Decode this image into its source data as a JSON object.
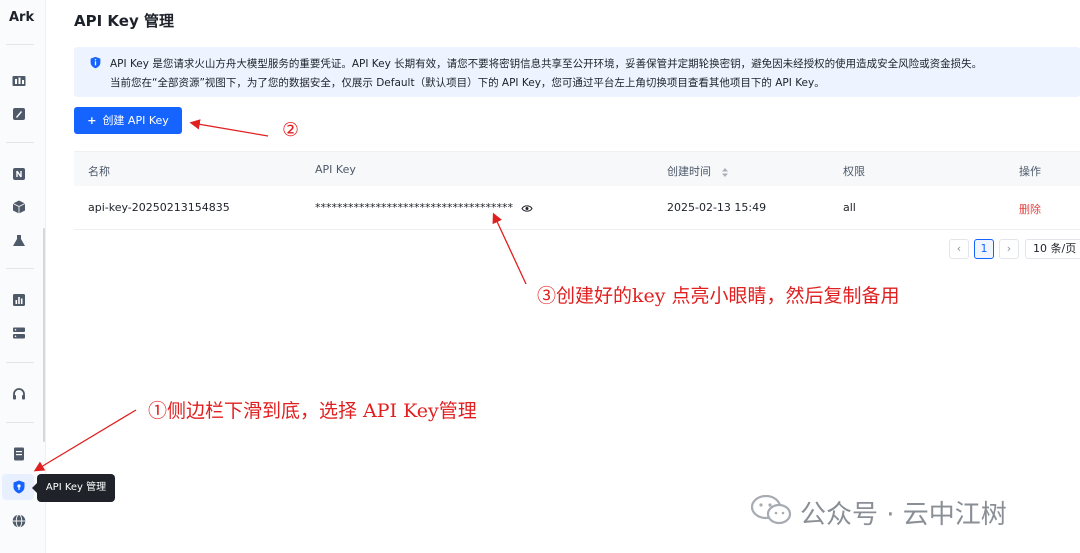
{
  "app": {
    "logo": "Ark"
  },
  "sidebar": {
    "icons": [
      "overview-icon",
      "rocket-icon",
      "model-icon",
      "box-icon",
      "flask-icon",
      "chart-icon",
      "server-icon",
      "headset-icon",
      "document-icon",
      "shield-key-icon",
      "globe-icon"
    ],
    "tooltip": "API Key 管理"
  },
  "page": {
    "title": "API Key 管理"
  },
  "notice": {
    "line1": "API Key 是您请求火山方舟大模型服务的重要凭证。API Key 长期有效，请您不要将密钥信息共享至公开环境，妥善保管并定期轮换密钥，避免因未经授权的使用造成安全风险或资金损失。",
    "line2": "当前您在“全部资源”视图下，为了您的数据安全，仅展示 Default（默认项目）下的 API Key，您可通过平台左上角切换项目查看其他项目下的 API Key。"
  },
  "toolbar": {
    "create_label": "创建 API Key",
    "create_icon": "plus-icon"
  },
  "table": {
    "headers": {
      "name": "名称",
      "key": "API Key",
      "created": "创建时间",
      "permission": "权限",
      "action": "操作"
    },
    "rows": [
      {
        "name": "api-key-20250213154835",
        "key": "************************************",
        "created": "2025-02-13 15:49",
        "permission": "all",
        "action": "删除"
      }
    ]
  },
  "pagination": {
    "prev": "‹",
    "current": "1",
    "next": "›",
    "page_size": "10 条/页"
  },
  "annotations": {
    "step1": "①侧边栏下滑到底，选择 API Key管理",
    "step2": "②",
    "step3": "③创建好的key 点亮小眼睛，然后复制备用",
    "color": "#e02020"
  },
  "watermark": {
    "text": "公众号 · 云中江树"
  },
  "colors": {
    "primary": "#1664ff",
    "danger": "#e54545",
    "notice_bg": "#eef4ff"
  }
}
